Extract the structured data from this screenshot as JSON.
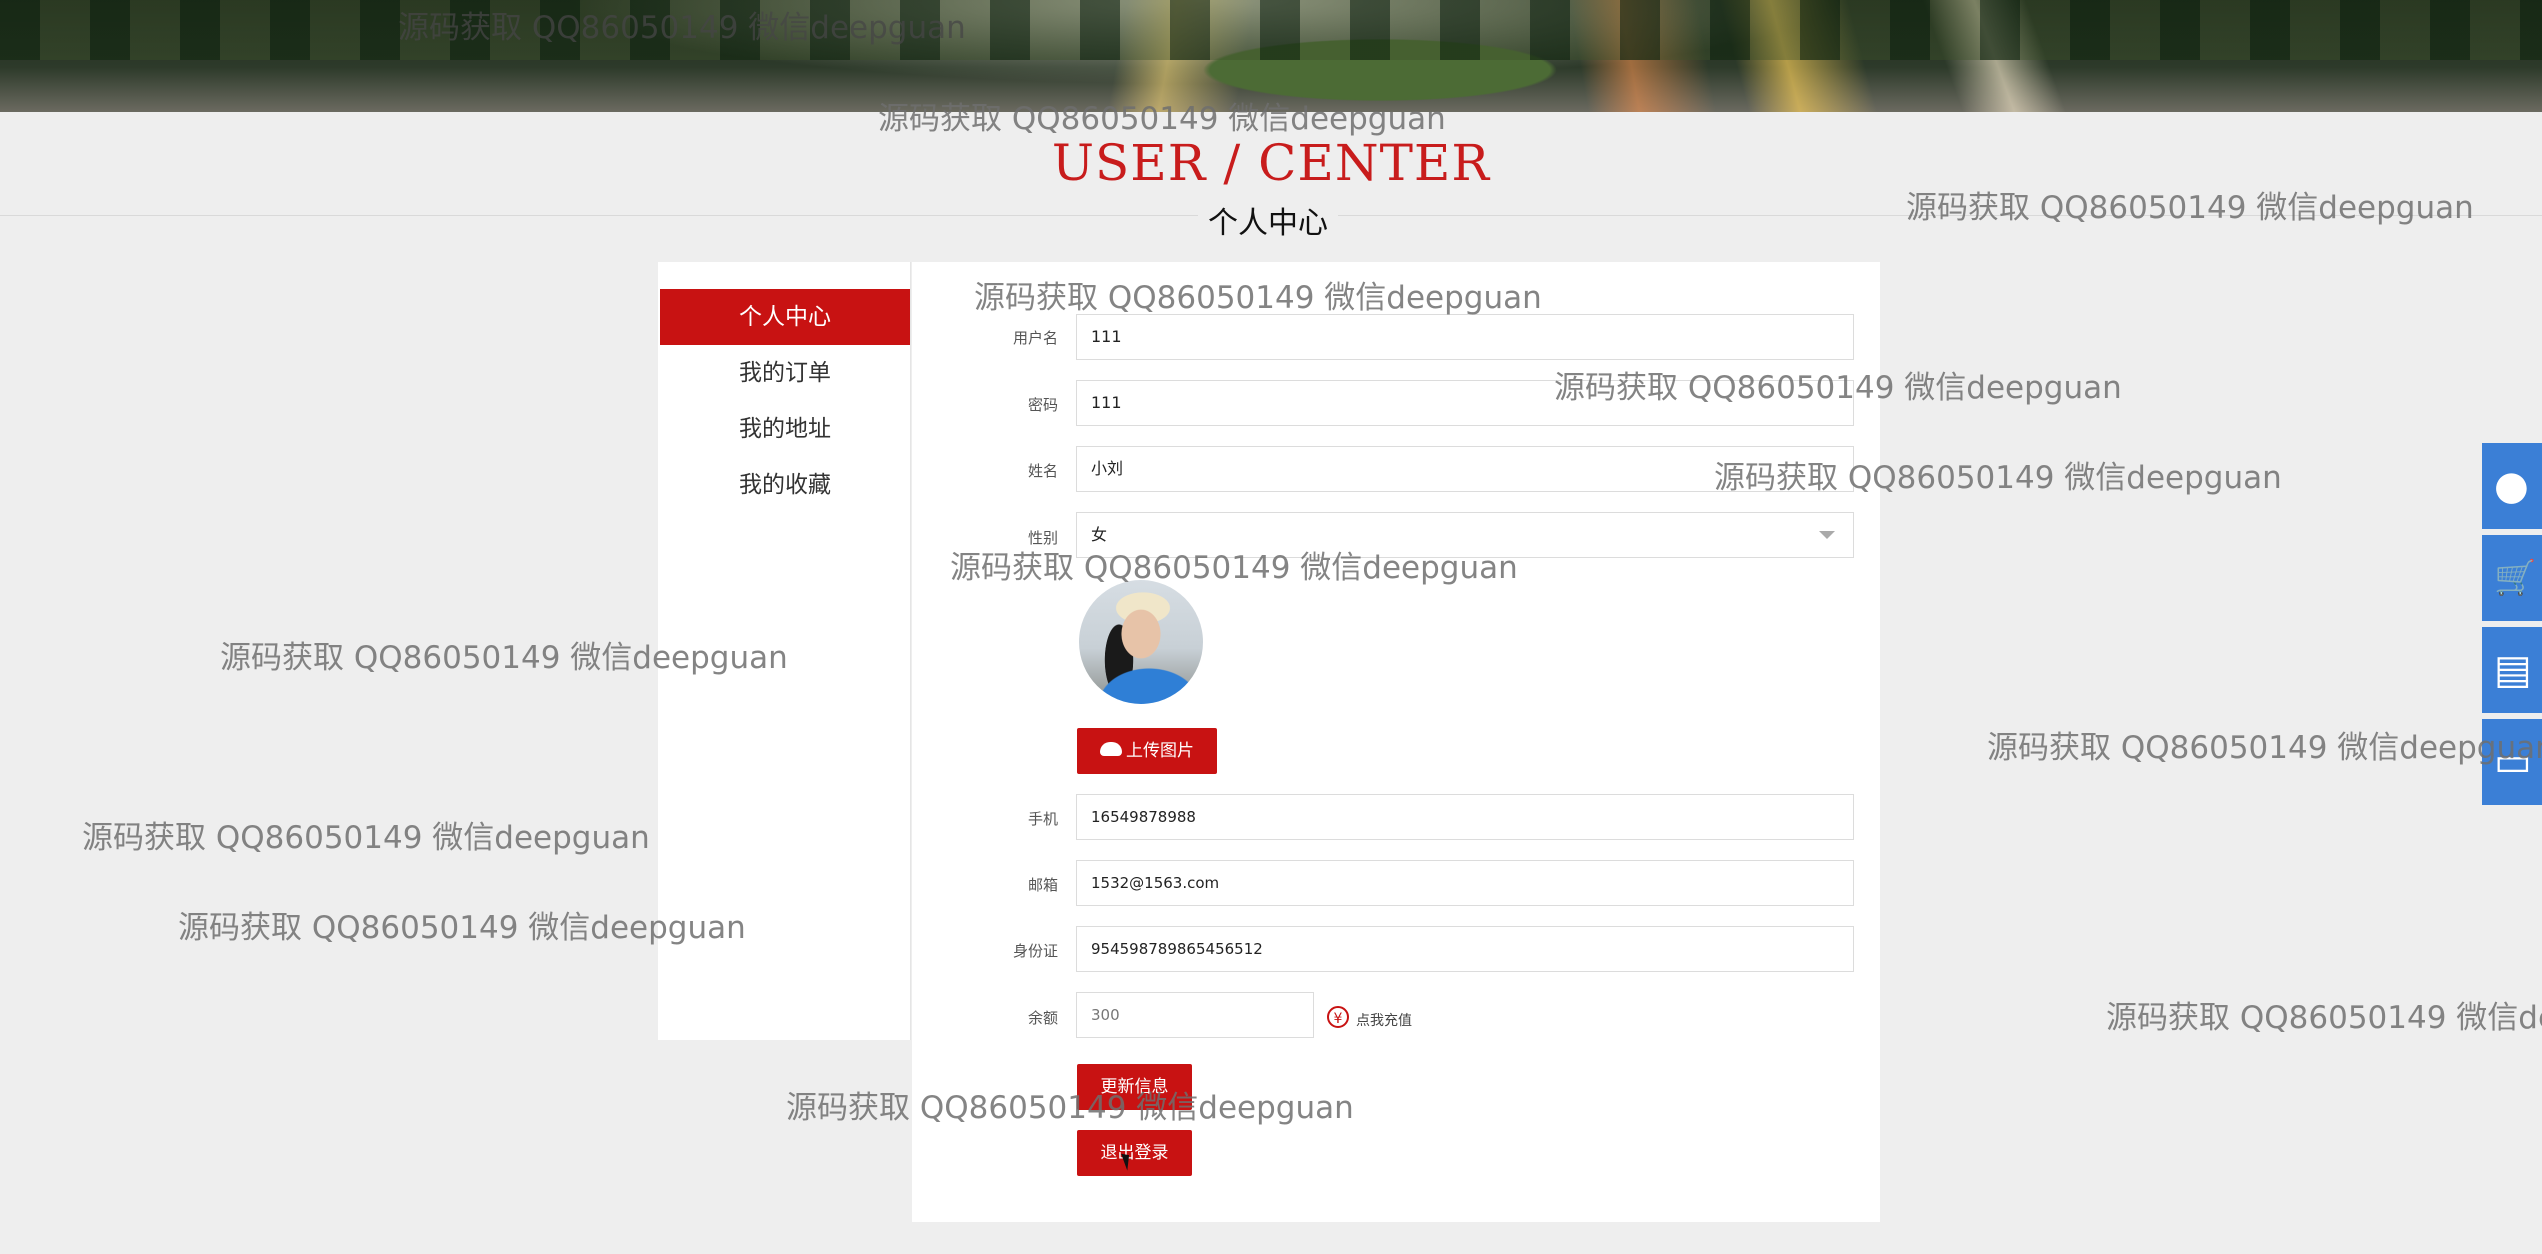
{
  "header": {
    "title_en": "USER / CENTER",
    "title_cn": "个人中心"
  },
  "sidebar": {
    "items": [
      {
        "label": "个人中心",
        "active": true
      },
      {
        "label": "我的订单",
        "active": false
      },
      {
        "label": "我的地址",
        "active": false
      },
      {
        "label": "我的收藏",
        "active": false
      }
    ]
  },
  "form": {
    "username": {
      "label": "用户名",
      "value": "111"
    },
    "password": {
      "label": "密码",
      "value": "111"
    },
    "name": {
      "label": "姓名",
      "value": "小刘"
    },
    "gender": {
      "label": "性别",
      "value": "女"
    },
    "upload_label": "上传图片",
    "phone": {
      "label": "手机",
      "value": "16549878988"
    },
    "email": {
      "label": "邮箱",
      "value": "1532@1563.com"
    },
    "id_card": {
      "label": "身份证",
      "value": "954598789865456512"
    },
    "balance": {
      "label": "余额",
      "value": "300",
      "recharge_label": "点我充值",
      "recharge_icon": "¥"
    },
    "update_label": "更新信息",
    "logout_label": "退出登录"
  },
  "side_tools": [
    {
      "icon": "user-icon"
    },
    {
      "icon": "cart-icon"
    },
    {
      "icon": "message-icon"
    },
    {
      "icon": "screen-icon"
    }
  ],
  "watermark": "源码获取 QQ86050149 微信deepguan",
  "watermark_partial": "源码获取 QQ86050149 微信dee",
  "colors": {
    "accent": "#c81212",
    "tool": "#3b7fd6"
  }
}
